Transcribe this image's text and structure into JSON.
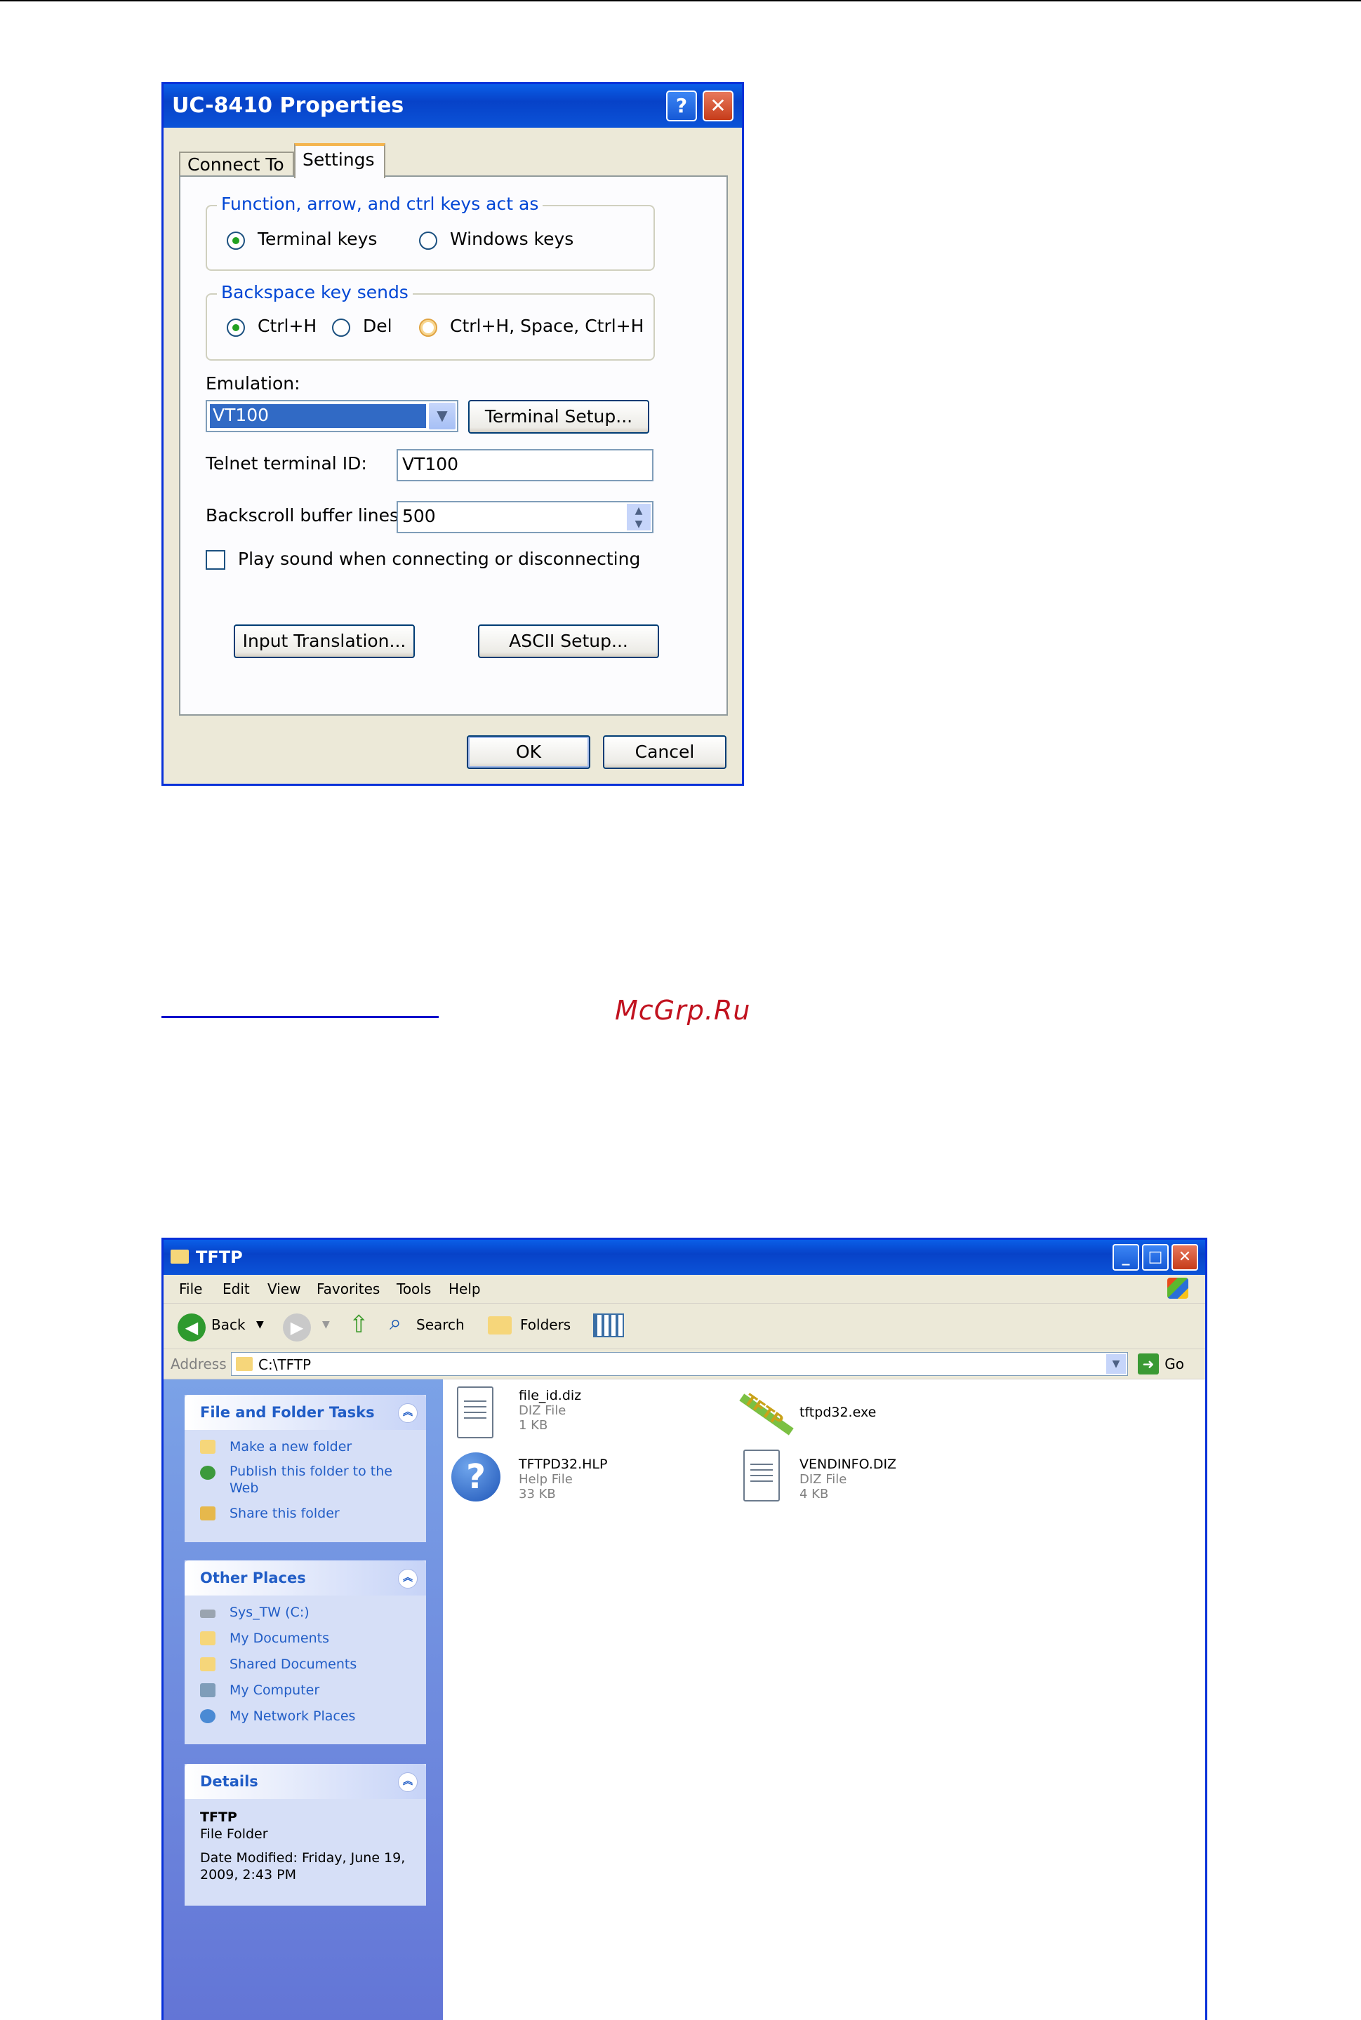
{
  "dialog": {
    "title": "UC-8410 Properties",
    "help_glyph": "?",
    "close_glyph": "✕",
    "tabs": [
      "Connect To",
      "Settings"
    ],
    "group_keys": {
      "title": "Function, arrow, and ctrl keys act as",
      "options": [
        "Terminal keys",
        "Windows keys"
      ],
      "selected": "Terminal keys"
    },
    "group_backspace": {
      "title": "Backspace key sends",
      "options": [
        "Ctrl+H",
        "Del",
        "Ctrl+H, Space, Ctrl+H"
      ],
      "selected": "Ctrl+H"
    },
    "emulation_label": "Emulation:",
    "emulation_value": "VT100",
    "terminal_setup_button": "Terminal Setup...",
    "telnet_id_label": "Telnet terminal ID:",
    "telnet_id_value": "VT100",
    "backscroll_label": "Backscroll buffer lines:",
    "backscroll_value": "500",
    "play_sound_label": "Play sound when connecting or disconnecting",
    "play_sound_checked": false,
    "input_translation_button": "Input Translation...",
    "ascii_setup_button": "ASCII Setup...",
    "ok_button": "OK",
    "cancel_button": "Cancel"
  },
  "watermark": "McGrp.Ru",
  "explorer": {
    "title": "TFTP",
    "menu": [
      "File",
      "Edit",
      "View",
      "Favorites",
      "Tools",
      "Help"
    ],
    "toolbar": {
      "back": "Back",
      "search": "Search",
      "folders": "Folders"
    },
    "address_label": "Address",
    "address_value": "C:\\TFTP",
    "go_label": "Go",
    "tasks": {
      "title": "File and Folder Tasks",
      "items": [
        "Make a new folder",
        "Publish this folder to the Web",
        "Share this folder"
      ]
    },
    "other_places": {
      "title": "Other Places",
      "items": [
        "Sys_TW (C:)",
        "My Documents",
        "Shared Documents",
        "My Computer",
        "My Network Places"
      ]
    },
    "details": {
      "title": "Details",
      "name": "TFTP",
      "type": "File Folder",
      "modified": "Date Modified: Friday, June 19, 2009, 2:43 PM"
    },
    "files": [
      {
        "name": "file_id.diz",
        "type": "DIZ File",
        "size": "1 KB",
        "icon": "text-document-icon"
      },
      {
        "name": "tftpd32.exe",
        "type": "",
        "size": "",
        "icon": "tftp-app-icon"
      },
      {
        "name": "TFTPD32.HLP",
        "type": "Help File",
        "size": "33 KB",
        "icon": "help-file-icon"
      },
      {
        "name": "VENDINFO.DIZ",
        "type": "DIZ File",
        "size": "4 KB",
        "icon": "text-document-icon"
      }
    ]
  },
  "colors": {
    "xp_blue": "#0A5FE8",
    "dialog_bg": "#ECE9D8",
    "link_blue": "#215DC6",
    "watermark_red": "#C1121F"
  }
}
